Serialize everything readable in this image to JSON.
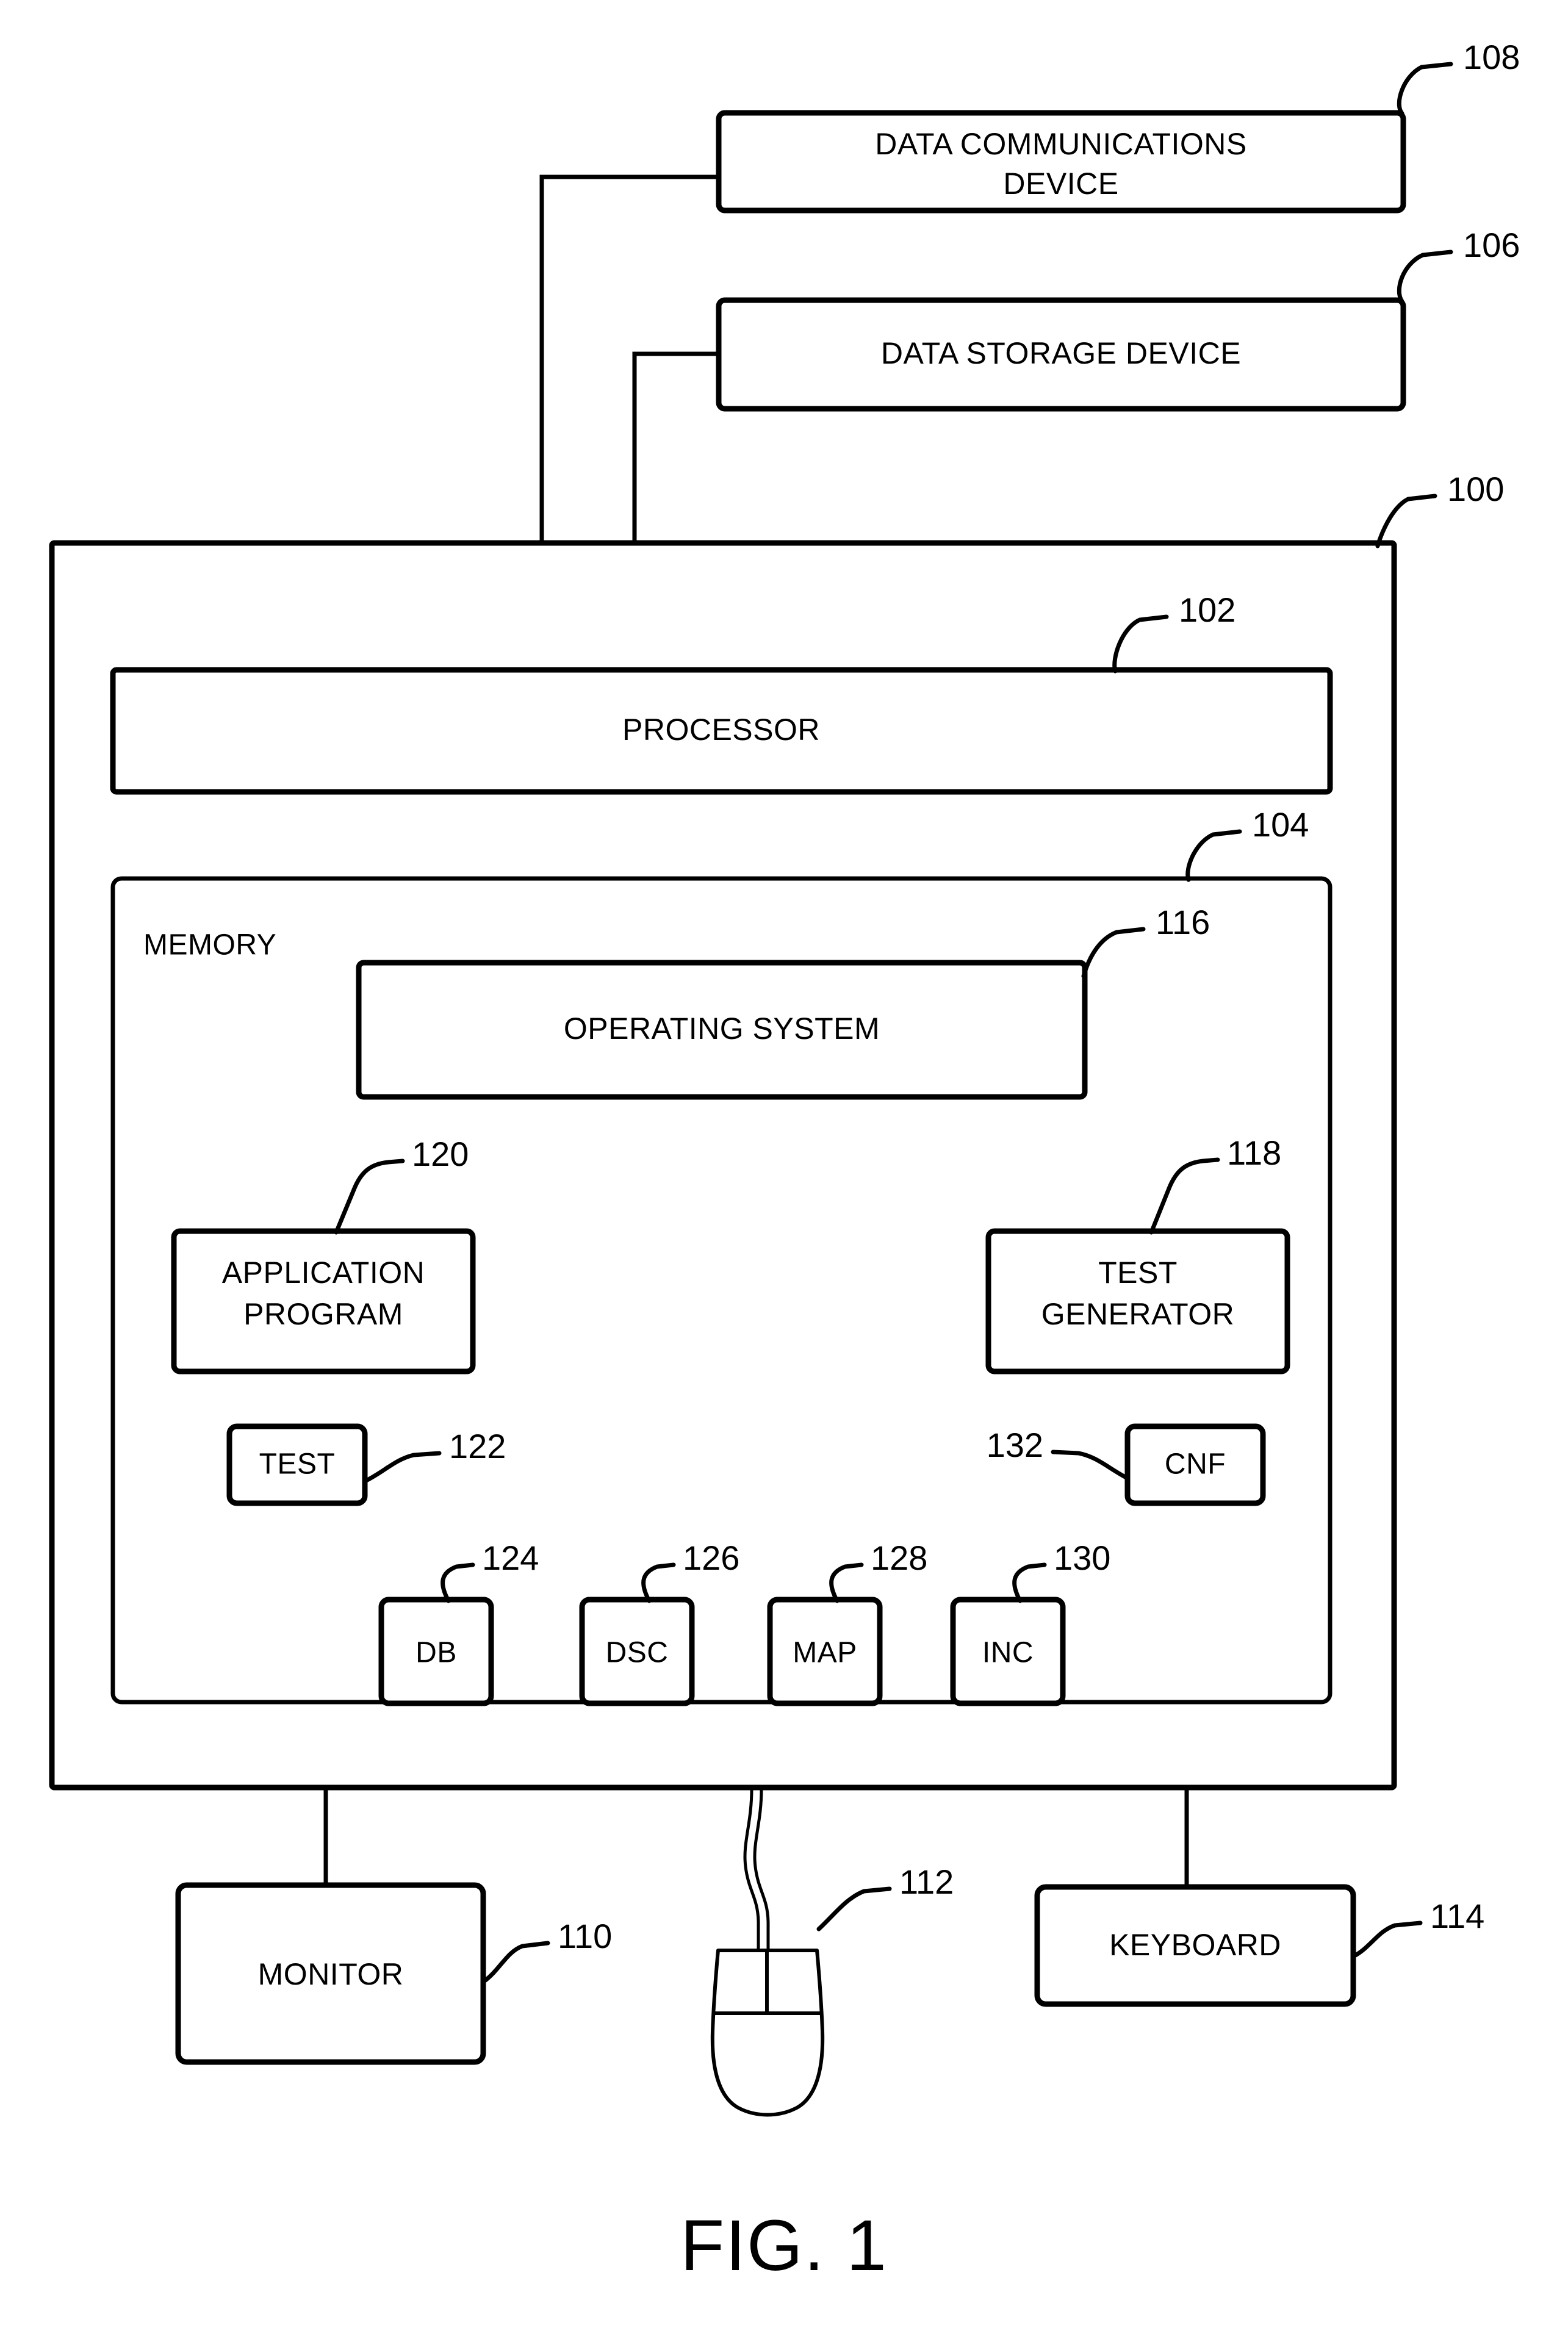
{
  "figure": {
    "caption": "FIG. 1",
    "title": "Computer system block diagram"
  },
  "blocks": {
    "data_communications_device": {
      "label_line1": "DATA COMMUNICATIONS",
      "label_line2": "DEVICE",
      "ref": "108"
    },
    "data_storage_device": {
      "label": "DATA STORAGE DEVICE",
      "ref": "106"
    },
    "computer": {
      "ref": "100"
    },
    "processor": {
      "label": "PROCESSOR",
      "ref": "102"
    },
    "memory": {
      "label": "MEMORY",
      "ref": "104"
    },
    "operating_system": {
      "label": "OPERATING SYSTEM",
      "ref": "116"
    },
    "application_program": {
      "label_line1": "APPLICATION",
      "label_line2": "PROGRAM",
      "ref": "120"
    },
    "test_generator": {
      "label_line1": "TEST",
      "label_line2": "GENERATOR",
      "ref": "118"
    },
    "test": {
      "label": "TEST",
      "ref": "122"
    },
    "cnf": {
      "label": "CNF",
      "ref": "132"
    },
    "db": {
      "label": "DB",
      "ref": "124"
    },
    "dsc": {
      "label": "DSC",
      "ref": "126"
    },
    "map": {
      "label": "MAP",
      "ref": "128"
    },
    "inc": {
      "label": "INC",
      "ref": "130"
    },
    "monitor": {
      "label": "MONITOR",
      "ref": "110"
    },
    "mouse": {
      "label": "",
      "ref": "112"
    },
    "keyboard": {
      "label": "KEYBOARD",
      "ref": "114"
    }
  },
  "style": {
    "ink": "#000000",
    "paper": "#ffffff"
  }
}
